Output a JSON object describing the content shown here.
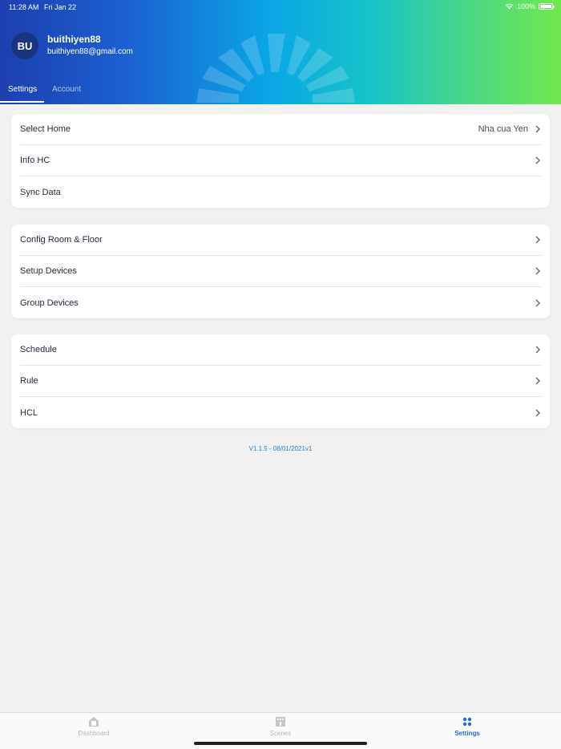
{
  "status_bar": {
    "time": "11:28 AM",
    "date": "Fri Jan 22",
    "battery": "100%"
  },
  "profile": {
    "initials": "BU",
    "username": "buithiyen88",
    "email": "buithiyen88@gmail.com"
  },
  "tabs": [
    {
      "label": "Settings",
      "active": true
    },
    {
      "label": "Account",
      "active": false
    }
  ],
  "groups": [
    {
      "items": [
        {
          "label": "Select Home",
          "value": "Nha cua Yen",
          "chevron": true
        },
        {
          "label": "Info HC",
          "value": "",
          "chevron": true
        },
        {
          "label": "Sync Data",
          "value": "",
          "chevron": false
        }
      ]
    },
    {
      "items": [
        {
          "label": "Config Room & Floor",
          "value": "",
          "chevron": true
        },
        {
          "label": "Setup Devices",
          "value": "",
          "chevron": true
        },
        {
          "label": "Group Devices",
          "value": "",
          "chevron": true
        }
      ]
    },
    {
      "items": [
        {
          "label": "Schedule",
          "value": "",
          "chevron": true
        },
        {
          "label": "Rule",
          "value": "",
          "chevron": true
        },
        {
          "label": "HCL",
          "value": "",
          "chevron": true
        }
      ]
    }
  ],
  "version": "V1.1.5 - 08/01/2021v1",
  "bottom_nav": [
    {
      "label": "Dashboard",
      "icon": "home-icon",
      "active": false
    },
    {
      "label": "Scenes",
      "icon": "scenes-icon",
      "active": false
    },
    {
      "label": "Settings",
      "icon": "settings-grid-icon",
      "active": true
    }
  ],
  "colors": {
    "accent": "#1e6fd6",
    "avatar_bg": "#1b3482",
    "version_text": "#2a7fc6",
    "background": "#f1f1f1"
  }
}
